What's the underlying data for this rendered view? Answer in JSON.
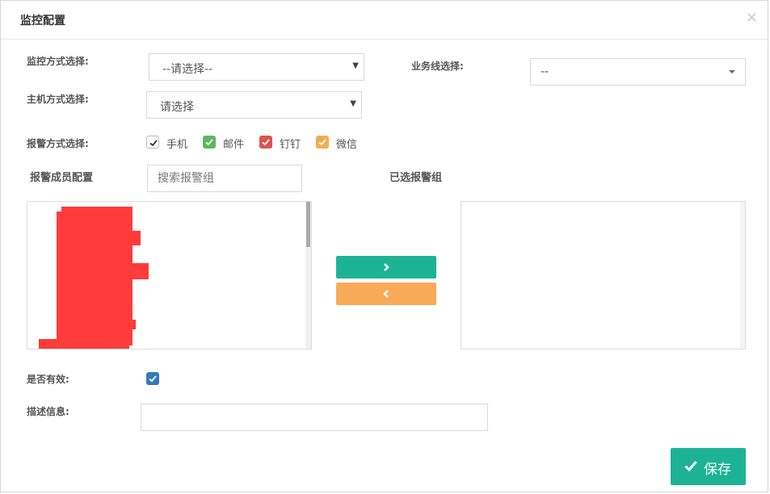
{
  "header": {
    "title": "监控配置",
    "close_symbol": "×"
  },
  "form": {
    "monitor_mode": {
      "label": "监控方式选择:",
      "value": "--请选择--"
    },
    "business_line": {
      "label": "业务线选择:",
      "value": "--"
    },
    "host_mode": {
      "label": "主机方式选择:",
      "value": "请选择"
    },
    "alert_mode": {
      "label": "报警方式选择:",
      "options": [
        {
          "label": "手机",
          "checked": true,
          "color": "#ffffff"
        },
        {
          "label": "邮件",
          "checked": true,
          "color": "#5cb85c"
        },
        {
          "label": "钉钉",
          "checked": true,
          "color": "#d9534f"
        },
        {
          "label": "微信",
          "checked": true,
          "color": "#f0ad4e"
        }
      ]
    },
    "alert_members": {
      "label": "报警成员配置",
      "search_placeholder": "搜索报警组"
    },
    "selected_groups": {
      "label": "已选报警组"
    },
    "is_valid": {
      "label": "是否有效:",
      "checked": true
    },
    "description": {
      "label": "描述信息:",
      "value": ""
    }
  },
  "buttons": {
    "move_right_icon": "chevron-right-icon",
    "move_left_icon": "chevron-left-icon",
    "save_label": "保存"
  },
  "colors": {
    "primary": "#1cb394",
    "warning": "#f8ac59",
    "checkbox_blue": "#337ab7"
  }
}
